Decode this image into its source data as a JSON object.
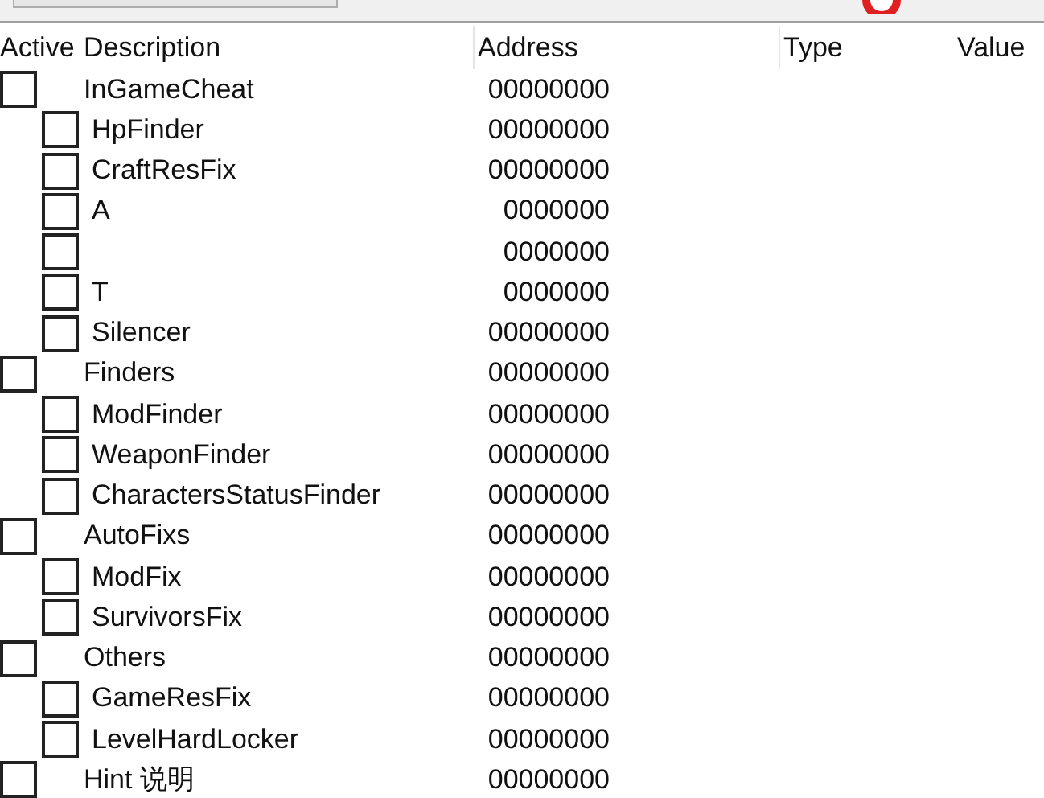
{
  "toolbar": {
    "cut_off_button": true
  },
  "table": {
    "columns": [
      "Active",
      "Description",
      "Address",
      "Type",
      "Value"
    ],
    "rows": [
      {
        "description": "InGameCheat",
        "address": "00000000",
        "checked": false,
        "children": [
          {
            "description": "HpFinder",
            "address": "00000000",
            "checked": false
          },
          {
            "description": "CraftResFix",
            "address": "00000000",
            "checked": false
          },
          {
            "description": "A",
            "address": "0000000",
            "checked": false
          },
          {
            "address": "0000000",
            "checked": false
          },
          {
            "description": "T",
            "address": "0000000",
            "checked": false
          },
          {
            "description": "Silencer",
            "address": "00000000",
            "checked": false
          }
        ]
      },
      {
        "description": "Finders",
        "address": "00000000",
        "checked": false,
        "children": [
          {
            "description": "ModFinder",
            "address": "00000000",
            "checked": false
          },
          {
            "description": "WeaponFinder",
            "address": "00000000",
            "checked": false
          },
          {
            "description": "CharactersStatusFinder",
            "address": "00000000",
            "checked": false
          }
        ]
      },
      {
        "description": "AutoFixs",
        "address": "00000000",
        "checked": false,
        "children": [
          {
            "description": "ModFix",
            "address": "00000000",
            "checked": false
          },
          {
            "description": "SurvivorsFix",
            "address": "00000000",
            "checked": false
          }
        ]
      },
      {
        "description": "Others",
        "address": "00000000",
        "checked": false,
        "children": [
          {
            "description": "GameResFix",
            "address": "00000000",
            "checked": false
          },
          {
            "description": "LevelHardLocker",
            "address": "00000000",
            "checked": false
          }
        ]
      },
      {
        "description": "Hint 说明",
        "address": "00000000",
        "checked": false
      }
    ]
  }
}
